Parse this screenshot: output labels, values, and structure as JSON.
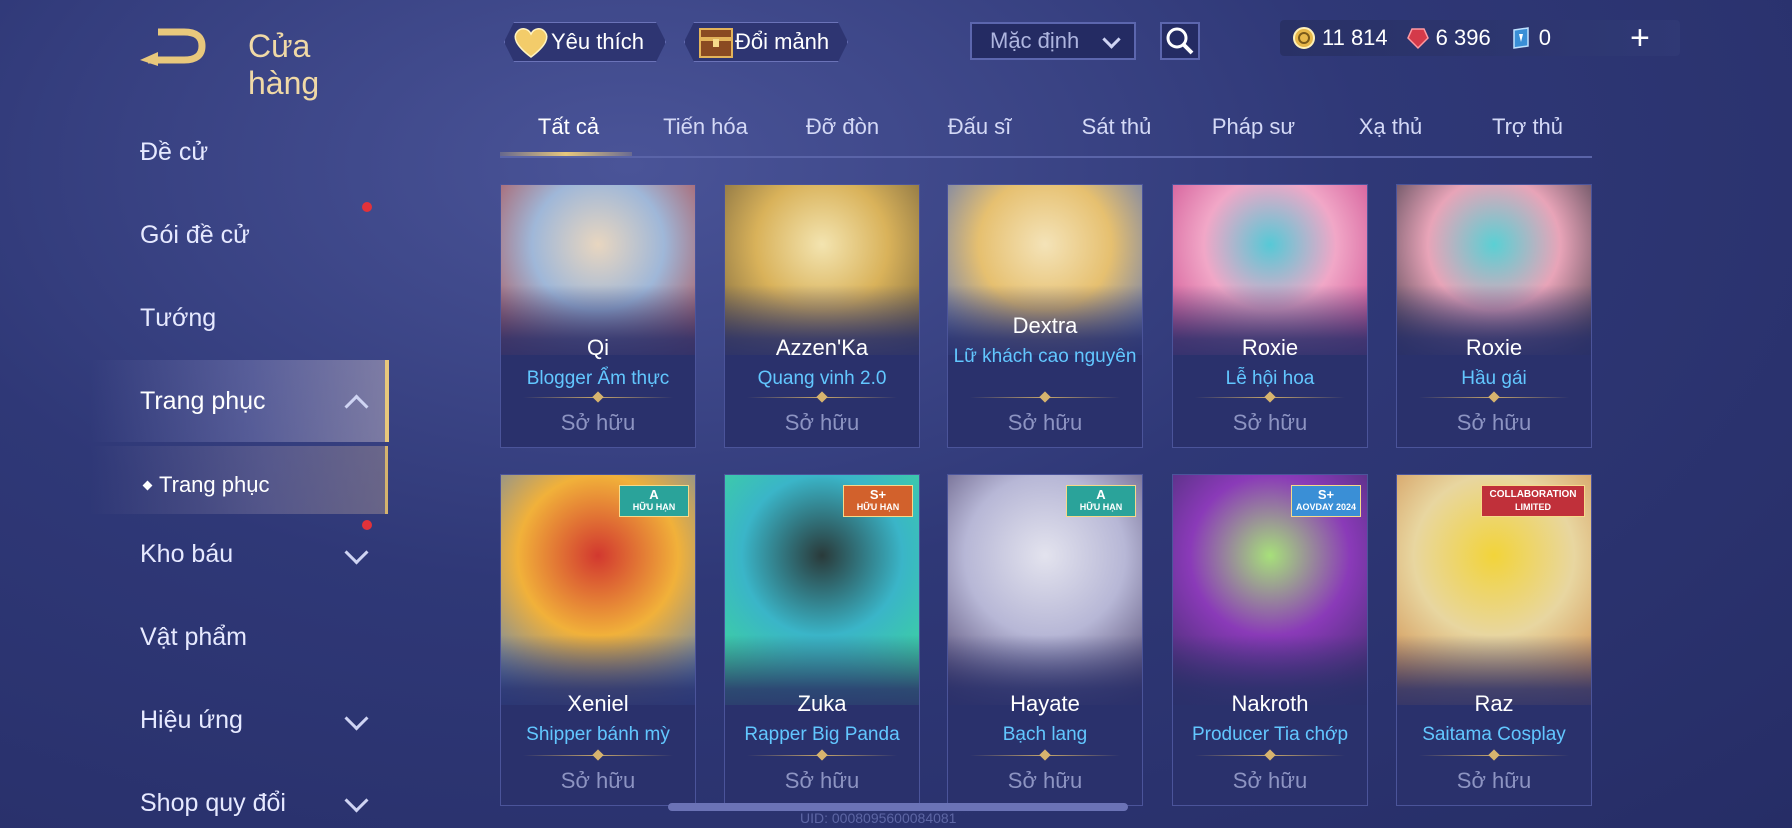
{
  "header": {
    "title": "Cửa hàng",
    "favorite_label": "Yêu thích",
    "exchange_label": "Đổi mảnh",
    "sort_value": "Mặc định"
  },
  "currencies": [
    {
      "icon": "gold-coin-icon",
      "value": "11 814"
    },
    {
      "icon": "red-gem-icon",
      "value": "6 396"
    },
    {
      "icon": "blue-voucher-icon",
      "value": "0"
    }
  ],
  "sidebar": {
    "items": [
      {
        "label": "Đề cử",
        "badge": false,
        "chevron": "none"
      },
      {
        "label": "Gói đề cử",
        "badge": true,
        "chevron": "none"
      },
      {
        "label": "Tướng",
        "badge": false,
        "chevron": "none"
      },
      {
        "label": "Trang phục",
        "badge": false,
        "chevron": "up"
      },
      {
        "label": "Kho báu",
        "badge": true,
        "chevron": "down"
      },
      {
        "label": "Vật phẩm",
        "badge": false,
        "chevron": "none"
      },
      {
        "label": "Hiệu ứng",
        "badge": false,
        "chevron": "down"
      },
      {
        "label": "Shop quy đổi",
        "badge": false,
        "chevron": "down"
      }
    ],
    "sub_item": "Trang phục"
  },
  "tabs": [
    "Tất cả",
    "Tiến hóa",
    "Đỡ đòn",
    "Đấu sĩ",
    "Sát thủ",
    "Pháp sư",
    "Xạ thủ",
    "Trợ thủ"
  ],
  "active_tab": "Tất cả",
  "cards": [
    {
      "hero": "Qi",
      "skin": "Blogger Ẩm thực",
      "status": "Sở hữu",
      "colors": [
        "#9fb7d8",
        "#e8d6c0",
        "#b04040"
      ]
    },
    {
      "hero": "Azzen'Ka",
      "skin": "Quang vinh 2.0",
      "status": "Sở hữu",
      "colors": [
        "#d9b25a",
        "#f3e4b0",
        "#6a5a3a"
      ]
    },
    {
      "hero": "Dextra",
      "skin": "Lữ khách cao nguyên",
      "status": "Sở hữu",
      "colors": [
        "#e6c070",
        "#f4e3b8",
        "#4a6ac0"
      ]
    },
    {
      "hero": "Roxie",
      "skin": "Lễ hội hoa",
      "status": "Sở hữu",
      "colors": [
        "#f1a7c7",
        "#56c9d6",
        "#c73d86"
      ]
    },
    {
      "hero": "Roxie",
      "skin": "Hầu gái",
      "status": "Sở hữu",
      "colors": [
        "#e8a4b8",
        "#5ad0d4",
        "#2c2c3a"
      ]
    },
    {
      "hero": "Xeniel",
      "skin": "Shipper bánh mỳ",
      "status": "Sở hữu",
      "colors": [
        "#f1b13a",
        "#d2382f",
        "#3a79d6"
      ],
      "badge": "A",
      "badge_sub": "HỮU HẠN",
      "badge_color": "#2aa39a"
    },
    {
      "hero": "Zuka",
      "skin": "Rapper Big Panda",
      "status": "Sở hữu",
      "colors": [
        "#3ab5c8",
        "#2a3a3a",
        "#3ee08a"
      ],
      "badge": "S+",
      "badge_sub": "HỮU HẠN",
      "badge_color": "#d2612c"
    },
    {
      "hero": "Hayate",
      "skin": "Bạch lang",
      "status": "Sở hữu",
      "colors": [
        "#b7b7d6",
        "#e3e3ee",
        "#3a2e5a"
      ],
      "badge": "A",
      "badge_sub": "HỮU HẠN",
      "badge_color": "#2aa39a"
    },
    {
      "hero": "Nakroth",
      "skin": "Producer Tia chớp",
      "status": "Sở hữu",
      "colors": [
        "#8a3ab8",
        "#a7e07a",
        "#2f2a5a"
      ],
      "badge": "S+",
      "badge_sub": "AOVDAY 2024",
      "badge_color": "#3a8fd6"
    },
    {
      "hero": "Raz",
      "skin": "Saitama Cosplay",
      "status": "Sở hữu",
      "colors": [
        "#e8d6a0",
        "#f2d43a",
        "#c87a3a"
      ],
      "badge": "COLLABORATION",
      "badge_sub": "LIMITED",
      "badge_color": "#c0303a"
    }
  ],
  "footer": {
    "uid": "UID: 0008095600084081"
  }
}
